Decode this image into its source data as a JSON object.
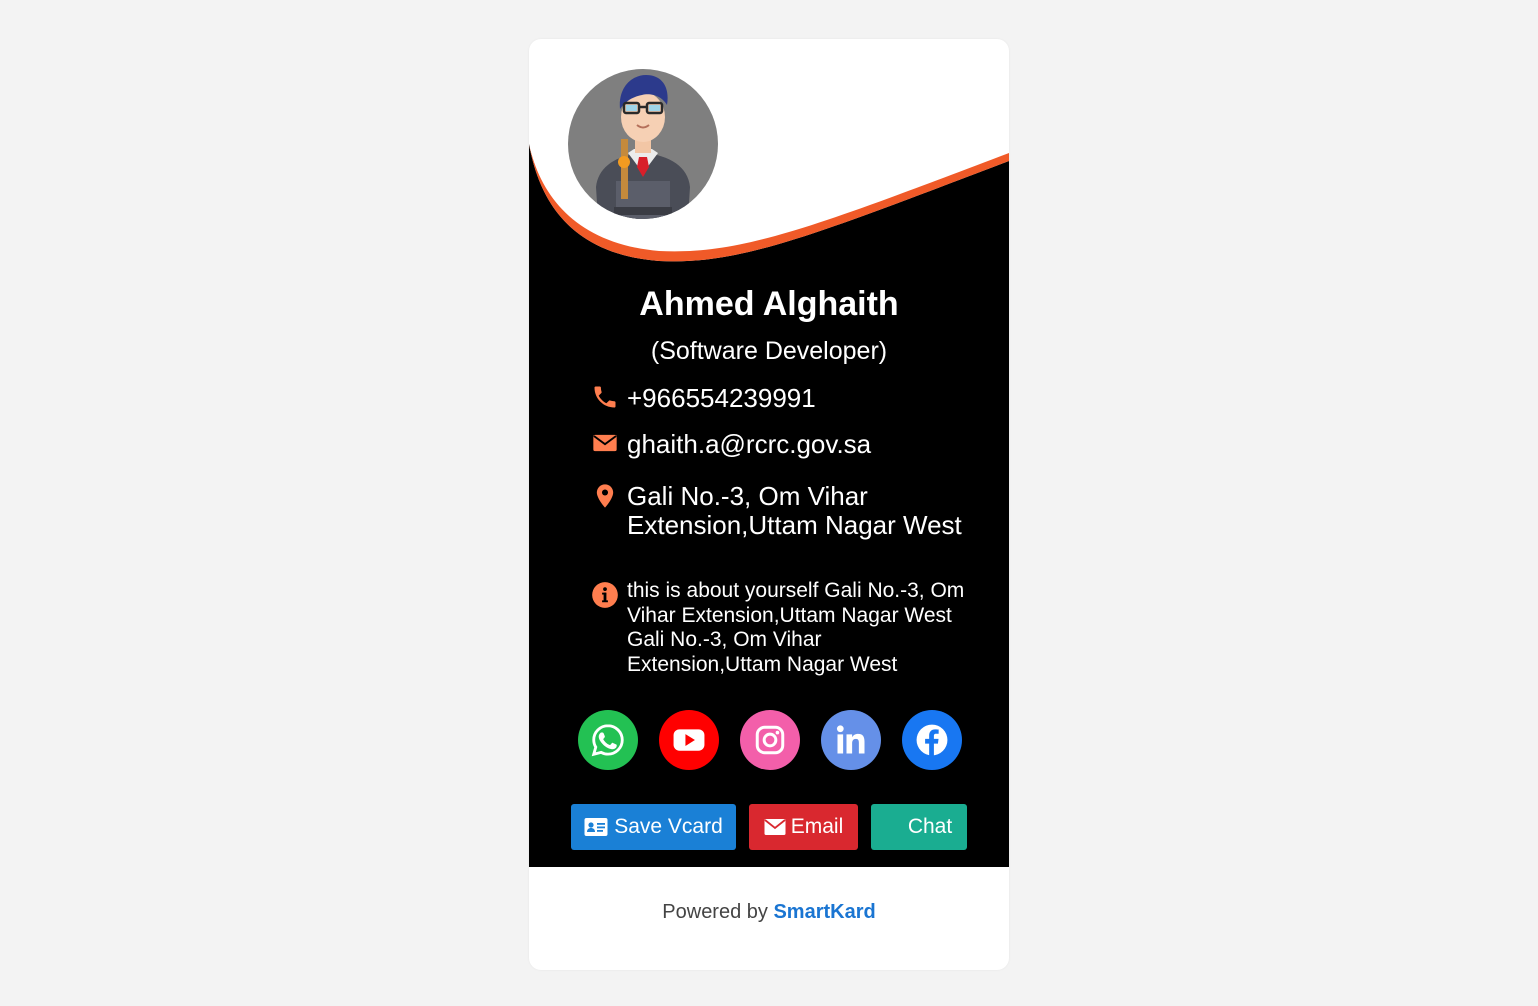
{
  "colors": {
    "page_bg": "#f3f3f3",
    "card_bg": "#ffffff",
    "hero_bg": "#000000",
    "accent_orange": "#f05a28",
    "icon_orange": "#ff7e4f",
    "whatsapp": "#23c153",
    "youtube": "#ff0000",
    "instagram": "#f35faa",
    "linkedin": "#6590e8",
    "facebook": "#1877f2",
    "btn_vcard": "#1a80d6",
    "btn_email": "#d9282f",
    "btn_chat": "#1aad91",
    "brand_link": "#1a75d2"
  },
  "profile": {
    "avatar_icon": "developer-avatar-icon",
    "name": "Ahmed Alghaith",
    "title": "(Software Developer)"
  },
  "contact": {
    "phone": {
      "icon": "phone-icon",
      "value": "+966554239991"
    },
    "email": {
      "icon": "envelope-icon",
      "value": "ghaith.a@rcrc.gov.sa"
    },
    "address": {
      "icon": "location-pin-icon",
      "line1": "Gali No.-3, Om Vihar",
      "line2": "Extension,Uttam Nagar West"
    },
    "about": {
      "icon": "info-icon",
      "lines": [
        "this is about yourself Gali No.-3, Om",
        "Vihar Extension,Uttam Nagar West",
        "Gali No.-3, Om Vihar",
        "Extension,Uttam Nagar West"
      ]
    }
  },
  "socials": [
    {
      "name": "whatsapp",
      "icon": "whatsapp-icon"
    },
    {
      "name": "youtube",
      "icon": "youtube-icon"
    },
    {
      "name": "instagram",
      "icon": "instagram-icon"
    },
    {
      "name": "linkedin",
      "icon": "linkedin-icon"
    },
    {
      "name": "facebook",
      "icon": "facebook-icon"
    }
  ],
  "actions": {
    "save_vcard": {
      "label": "Save Vcard",
      "icon": "id-card-icon"
    },
    "email": {
      "label": "Email",
      "icon": "envelope-icon"
    },
    "chat": {
      "label": "Chat"
    }
  },
  "footer": {
    "powered_prefix": "Powered by ",
    "brand": "SmartKard"
  }
}
